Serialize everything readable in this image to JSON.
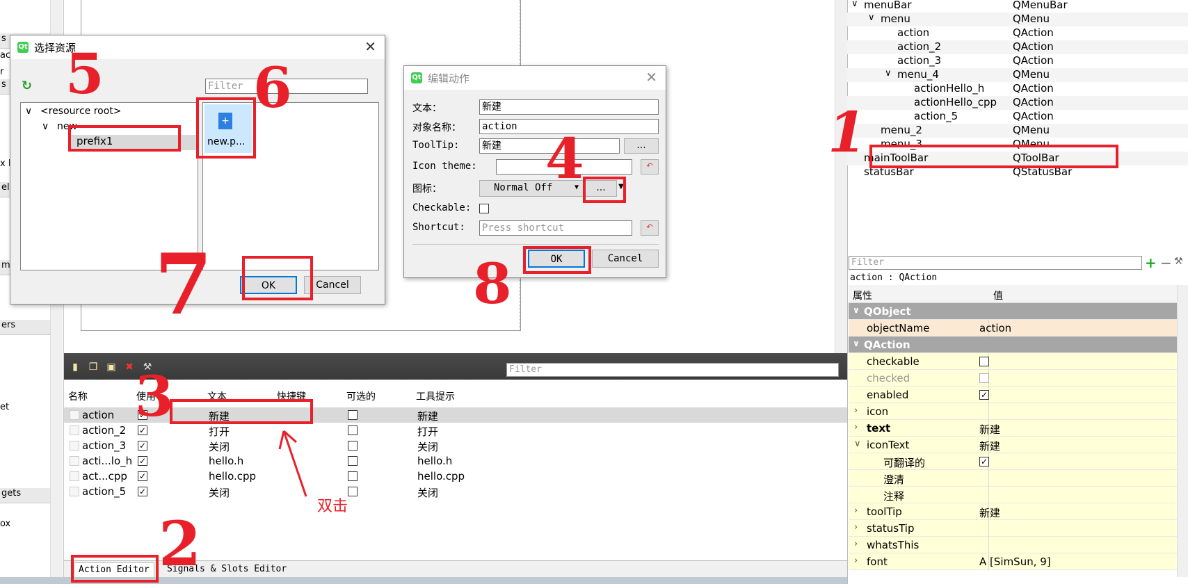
{
  "left_strip": {
    "fragments": [
      "s",
      "ace",
      "r",
      "s",
      "x B",
      "ele",
      "m-",
      "ers",
      "et",
      "gets",
      "ox"
    ]
  },
  "action_editor": {
    "filter_placeholder": "Filter",
    "headers": [
      "名称",
      "使用",
      "文本",
      "快捷键",
      "可选的",
      "工具提示"
    ],
    "rows": [
      {
        "name": "action",
        "used": true,
        "text": "新建",
        "shortcut": "",
        "checkable": false,
        "tooltip": "新建"
      },
      {
        "name": "action_2",
        "used": true,
        "text": "打开",
        "shortcut": "",
        "checkable": false,
        "tooltip": "打开"
      },
      {
        "name": "action_3",
        "used": true,
        "text": "关闭",
        "shortcut": "",
        "checkable": false,
        "tooltip": "关闭"
      },
      {
        "name": "acti...lo_h",
        "used": true,
        "text": "hello.h",
        "shortcut": "",
        "checkable": false,
        "tooltip": "hello.h"
      },
      {
        "name": "act...cpp",
        "used": true,
        "text": "hello.cpp",
        "shortcut": "",
        "checkable": false,
        "tooltip": "hello.cpp"
      },
      {
        "name": "action_5",
        "used": true,
        "text": "关闭",
        "shortcut": "",
        "checkable": false,
        "tooltip": "关闭"
      }
    ],
    "tabs": [
      "Action Editor",
      "Signals & Slots Editor"
    ]
  },
  "object_tree": [
    {
      "name": "menuBar",
      "class": "QMenuBar",
      "indent": 1,
      "arrow": "∨"
    },
    {
      "name": "menu",
      "class": "QMenu",
      "indent": 2,
      "arrow": "∨"
    },
    {
      "name": "action",
      "class": "QAction",
      "indent": 3,
      "arrow": ""
    },
    {
      "name": "action_2",
      "class": "QAction",
      "indent": 3,
      "arrow": ""
    },
    {
      "name": "action_3",
      "class": "QAction",
      "indent": 3,
      "arrow": ""
    },
    {
      "name": "menu_4",
      "class": "QMenu",
      "indent": 3,
      "arrow": "∨"
    },
    {
      "name": "actionHello_h",
      "class": "QAction",
      "indent": 4,
      "arrow": ""
    },
    {
      "name": "actionHello_cpp",
      "class": "QAction",
      "indent": 4,
      "arrow": ""
    },
    {
      "name": "action_5",
      "class": "QAction",
      "indent": 4,
      "arrow": ""
    },
    {
      "name": "menu_2",
      "class": "QMenu",
      "indent": 2,
      "arrow": ""
    },
    {
      "name": "menu_3",
      "class": "QMenu",
      "indent": 2,
      "arrow": ""
    },
    {
      "name": "mainToolBar",
      "class": "QToolBar",
      "indent": 1,
      "arrow": ""
    },
    {
      "name": "statusBar",
      "class": "QStatusBar",
      "indent": 1,
      "arrow": ""
    }
  ],
  "property_editor": {
    "filter_placeholder": "Filter",
    "object_label": "action : QAction",
    "col_property": "属性",
    "col_value": "值",
    "rows": [
      {
        "type": "group",
        "name": "QObject"
      },
      {
        "type": "peach",
        "name": "objectName",
        "value": "action"
      },
      {
        "type": "group",
        "name": "QAction"
      },
      {
        "type": "yel",
        "name": "checkable",
        "check": false
      },
      {
        "type": "yel",
        "name": "checked",
        "check": false,
        "disabled": true
      },
      {
        "type": "yel",
        "name": "enabled",
        "check": true
      },
      {
        "type": "yel",
        "name": "icon",
        "value": "",
        "expander": "›"
      },
      {
        "type": "yel",
        "name": "text",
        "value": "新建",
        "expander": "›",
        "bold": true
      },
      {
        "type": "yel",
        "name": "iconText",
        "value": "新建",
        "expander": "∨"
      },
      {
        "type": "yel",
        "name": "可翻译的",
        "check": true,
        "sub": true
      },
      {
        "type": "yel",
        "name": "澄清",
        "value": "",
        "sub": true
      },
      {
        "type": "yel",
        "name": "注释",
        "value": "",
        "sub": true
      },
      {
        "type": "yel",
        "name": "toolTip",
        "value": "新建",
        "expander": "›"
      },
      {
        "type": "yel",
        "name": "statusTip",
        "value": "",
        "expander": "›"
      },
      {
        "type": "yel",
        "name": "whatsThis",
        "value": "",
        "expander": "›"
      },
      {
        "type": "yel",
        "name": "font",
        "value": "A  [SimSun, 9]",
        "expander": "›"
      }
    ]
  },
  "resource_dialog": {
    "title": "选择资源",
    "filter_placeholder": "Filter",
    "tree": [
      "<resource root>",
      "new",
      "prefix1"
    ],
    "file": "new.p...",
    "ok": "OK",
    "cancel": "Cancel"
  },
  "edit_action_dialog": {
    "title": "编辑动作",
    "labels": {
      "text": "文本：",
      "object_name": "对象名称：",
      "tooltip": "ToolTip:",
      "icon_theme": "Icon theme:",
      "icon": "图标：",
      "checkable": "Checkable:",
      "shortcut": "Shortcut:"
    },
    "values": {
      "text": "新建",
      "object_name": "action",
      "tooltip": "新建",
      "icon_theme": "",
      "icon_mode": "Normal Off"
    },
    "shortcut_placeholder": "Press shortcut",
    "browse": "...",
    "ok": "OK",
    "cancel": "Cancel"
  },
  "annotations": {
    "n1": "1",
    "n2": "2",
    "n3": "3",
    "n4": "4",
    "n5": "5",
    "n6": "6",
    "n7": "7",
    "n8": "8",
    "double_click": "双击"
  },
  "colors": {
    "annotation_red": "#e8202a",
    "group_header": "#a6a6a6",
    "property_yellow": "#ffffd8"
  }
}
